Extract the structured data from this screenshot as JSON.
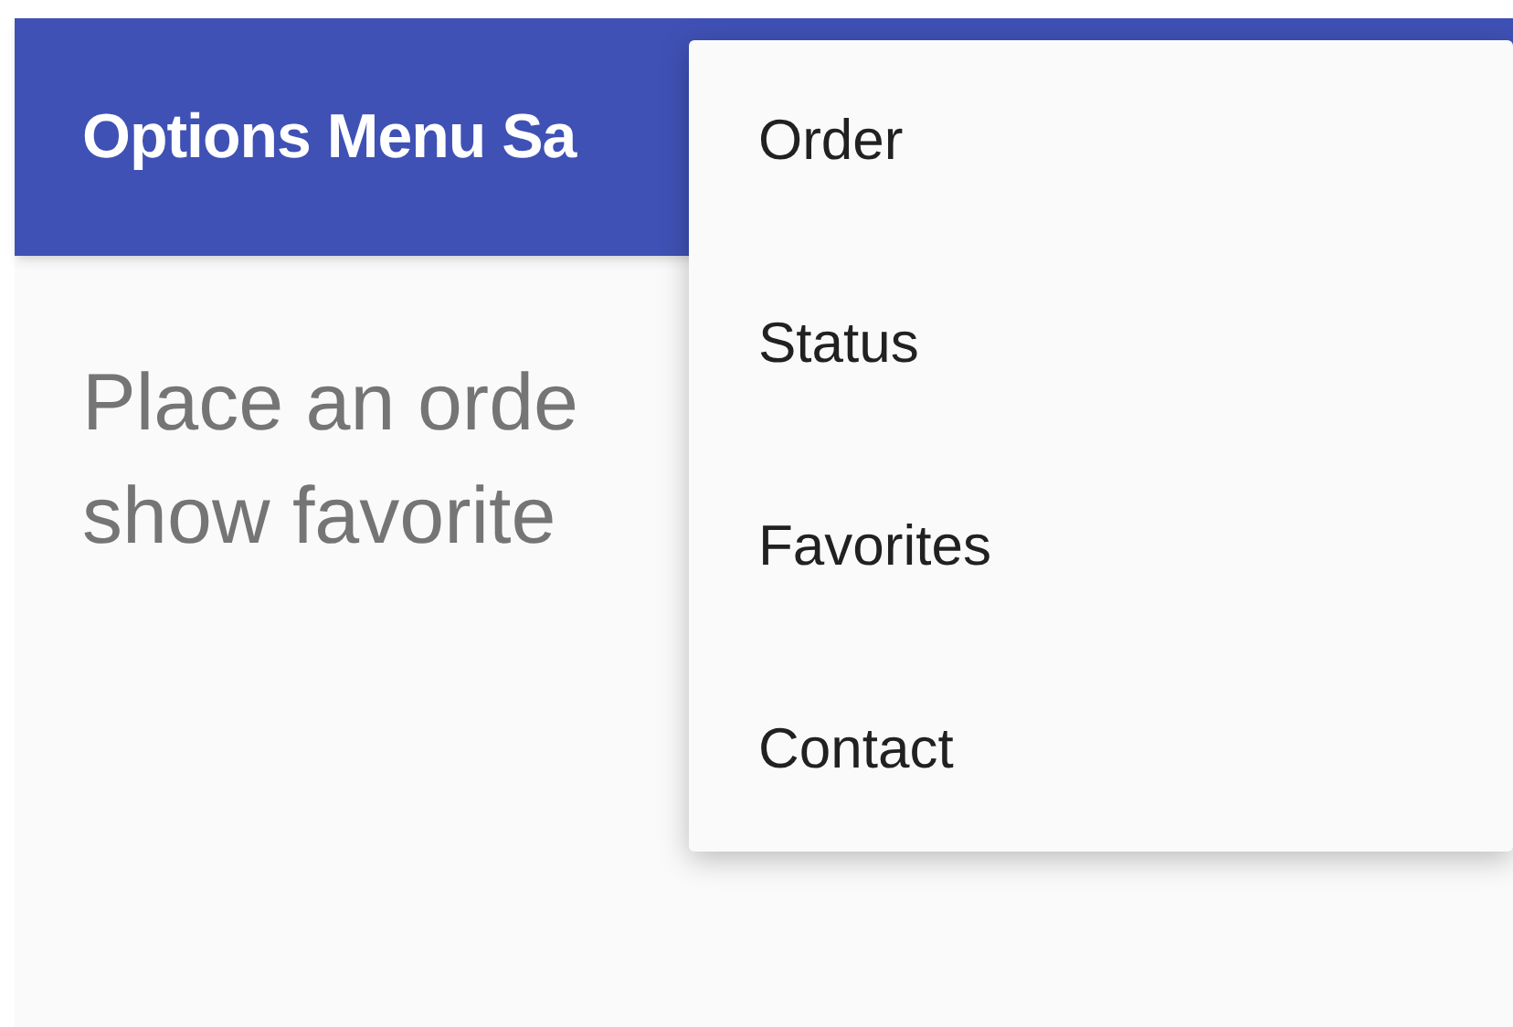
{
  "app_bar": {
    "title": "Options Menu Sa"
  },
  "body": {
    "lines": [
      "Place an orde",
      "show favorite"
    ]
  },
  "menu": {
    "items": [
      {
        "label": "Order"
      },
      {
        "label": "Status"
      },
      {
        "label": "Favorites"
      },
      {
        "label": "Contact"
      }
    ]
  }
}
